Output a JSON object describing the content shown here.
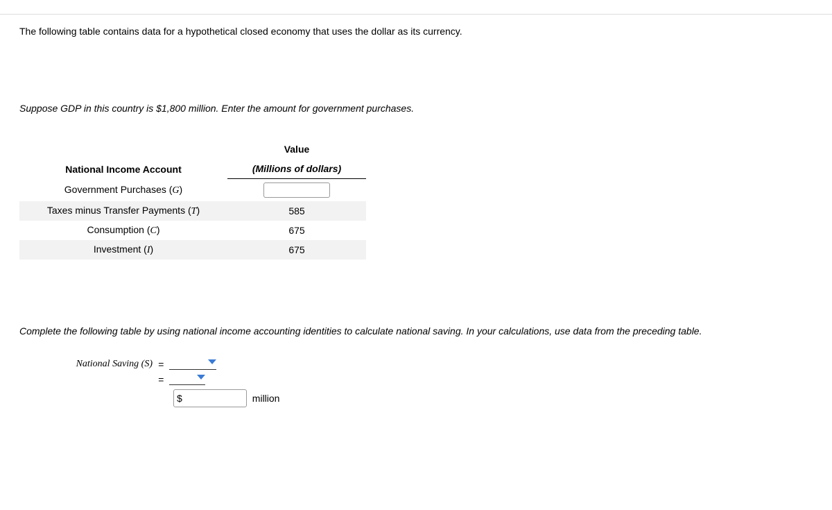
{
  "intro": "The following table contains data for a hypothetical closed economy that uses the dollar as its currency.",
  "instruction": "Suppose GDP in this country is $1,800 million. Enter the amount for government purchases.",
  "table": {
    "header_col1": "National Income Account",
    "header_col2_top": "Value",
    "header_col2_sub": "(Millions of dollars)",
    "rows": [
      {
        "label_pre": "Government Purchases (",
        "var": "G",
        "label_post": ")",
        "value": ""
      },
      {
        "label_pre": "Taxes minus Transfer Payments (",
        "var": "T",
        "label_post": ")",
        "value": "585"
      },
      {
        "label_pre": "Consumption (",
        "var": "C",
        "label_post": ")",
        "value": "675"
      },
      {
        "label_pre": "Investment (",
        "var": "I",
        "label_post": ")",
        "value": "675"
      }
    ]
  },
  "completion_text": "Complete the following table by using national income accounting identities to calculate national saving. In your calculations, use data from the preceding table.",
  "ns": {
    "label": "National Saving (S)",
    "equals": "=",
    "dollar": "$",
    "million": "million"
  }
}
